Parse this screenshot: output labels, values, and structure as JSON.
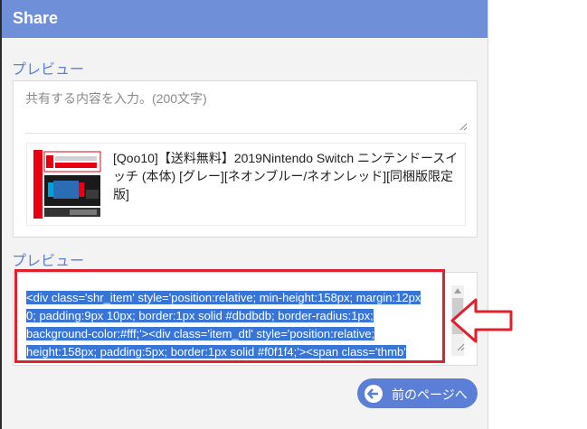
{
  "dialog": {
    "title": "Share",
    "preview_label_1": "プレビュー",
    "preview_label_2": "プレビュー",
    "share_input": {
      "placeholder": "共有する内容を入力。(200文字)",
      "value": ""
    },
    "item": {
      "thumbnail_icon": "nintendo-switch-product-image",
      "title": "[Qoo10]【送料無料】2019Nintendo Switch ニンテンドースイッチ (本体) [グレー][ネオンブルー/ネオンレッド][同梱版限定版]"
    },
    "code": {
      "line1": "<div class='shr_item' style='position:relative; min-height:158px; margin:12px",
      "line2": "0; padding:9px 10px; border:1px solid #dbdbdb; border-radius:1px;",
      "line3": "background-color:#fff;'><div class='item_dtl' style='position:relative;",
      "line4": "height:158px; padding:5px; border:1px solid #f0f1f4;'><span class='thmb'"
    },
    "back_button": {
      "label": "前のページへ",
      "icon": "left-arrow-icon"
    }
  },
  "annotations": {
    "highlight_color": "#e0202c",
    "arrow_icon": "outline-left-arrow-icon"
  },
  "colors": {
    "header": "#6f8fd8",
    "accent": "#5b7fd6",
    "selection": "#3875d7"
  }
}
